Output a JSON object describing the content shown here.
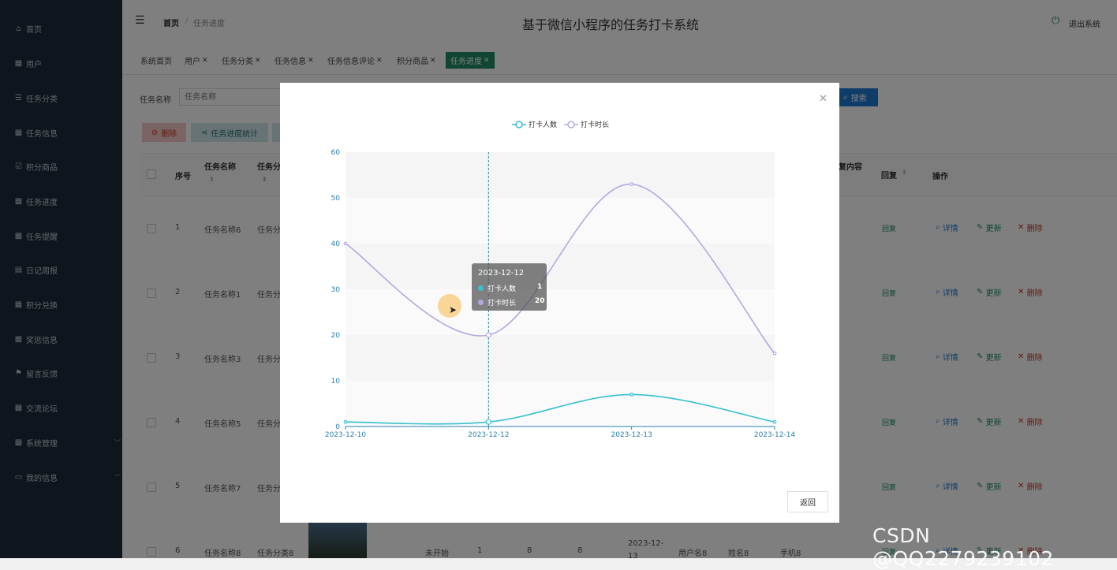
{
  "sidebar": {
    "items": [
      {
        "label": "首页",
        "icon": "home-icon"
      },
      {
        "label": "用户",
        "icon": "grid-icon"
      },
      {
        "label": "任务分类",
        "icon": "sliders-icon"
      },
      {
        "label": "任务信息",
        "icon": "grid-icon"
      },
      {
        "label": "积分商品",
        "icon": "check-square-icon"
      },
      {
        "label": "任务进度",
        "icon": "grid-icon"
      },
      {
        "label": "任务提醒",
        "icon": "apps-icon"
      },
      {
        "label": "日记周报",
        "icon": "clipboard-icon"
      },
      {
        "label": "积分兑换",
        "icon": "grid-icon"
      },
      {
        "label": "奖惩信息",
        "icon": "grid-icon"
      },
      {
        "label": "留言反馈",
        "icon": "flag-icon"
      },
      {
        "label": "交流论坛",
        "icon": "grid-icon"
      },
      {
        "label": "系统管理",
        "icon": "grid-icon",
        "expandable": true
      },
      {
        "label": "我的信息",
        "icon": "card-icon",
        "expandable": true
      }
    ]
  },
  "header": {
    "breadcrumb_home": "首页",
    "breadcrumb_sep": "/",
    "breadcrumb_current": "任务进度",
    "title": "基于微信小程序的任务打卡系统",
    "logout_label": "退出系统"
  },
  "tabs": [
    {
      "label": "系统首页",
      "closable": false
    },
    {
      "label": "用户",
      "closable": true
    },
    {
      "label": "任务分类",
      "closable": true
    },
    {
      "label": "任务信息",
      "closable": true
    },
    {
      "label": "任务信息评论",
      "closable": true
    },
    {
      "label": "积分商品",
      "closable": true
    },
    {
      "label": "任务进度",
      "closable": true,
      "active": true
    }
  ],
  "search": {
    "label": "任务名称",
    "placeholder": "任务名称",
    "button_label": "搜索"
  },
  "toolbar": {
    "delete_label": "删除",
    "stats_label": "任务进度统计"
  },
  "table": {
    "headers": {
      "index": "序号",
      "task_name": "任务名称",
      "task_category": "任务分",
      "reply_content": "复内容",
      "reply": "回复",
      "actions": "操作"
    },
    "rows": [
      {
        "index": "1",
        "task_name": "任务名称6",
        "category": "任务分",
        "reply": "回复"
      },
      {
        "index": "2",
        "task_name": "任务名称1",
        "category": "任务分",
        "reply": "回复"
      },
      {
        "index": "3",
        "task_name": "任务名称3",
        "category": "任务分",
        "reply": "回复"
      },
      {
        "index": "4",
        "task_name": "任务名称5",
        "category": "任务分",
        "reply": "回复"
      },
      {
        "index": "5",
        "task_name": "任务名称7",
        "category": "任务分",
        "reply": "回复"
      },
      {
        "index": "6",
        "task_name": "任务名称8",
        "category": "任务分类8",
        "status": "未开始",
        "c1": "1",
        "c2": "8",
        "c3": "8",
        "date": "2023-12-",
        "date2": "13",
        "user": "用户名8",
        "name": "姓名8",
        "phone": "手机8",
        "reply": "回复"
      }
    ],
    "action_labels": {
      "detail": "详情",
      "update": "更新",
      "delete": "删除"
    }
  },
  "modal": {
    "close_icon": "close-icon",
    "back_label": "返回",
    "tooltip": {
      "date": "2023-12-12",
      "rows": [
        {
          "name": "打卡人数",
          "value": "1"
        },
        {
          "name": "打卡时长",
          "value": "20"
        }
      ]
    }
  },
  "chart_data": {
    "type": "line",
    "smooth": true,
    "categories": [
      "2023-12-10",
      "2023-12-12",
      "2023-12-13",
      "2023-12-14"
    ],
    "series": [
      {
        "name": "打卡人数",
        "values": [
          1,
          1,
          7,
          1
        ],
        "color": "#36c0cf"
      },
      {
        "name": "打卡时长",
        "values": [
          40,
          20,
          53,
          16
        ],
        "color": "#b5a7e0"
      }
    ],
    "ylim": [
      0,
      60
    ],
    "yticks": [
      "0",
      "10",
      "20",
      "30",
      "40",
      "50",
      "60"
    ],
    "legend": "top-center",
    "grid": "horizontal-bands",
    "highlight_category": "2023-12-12"
  },
  "colors": {
    "sidebar_bg": "#1c2b3a",
    "accent_green": "#1f8a62",
    "primary_blue": "#1e7ad4",
    "danger_red": "#c0392b"
  },
  "watermark": "CSDN @QQ2279239102"
}
